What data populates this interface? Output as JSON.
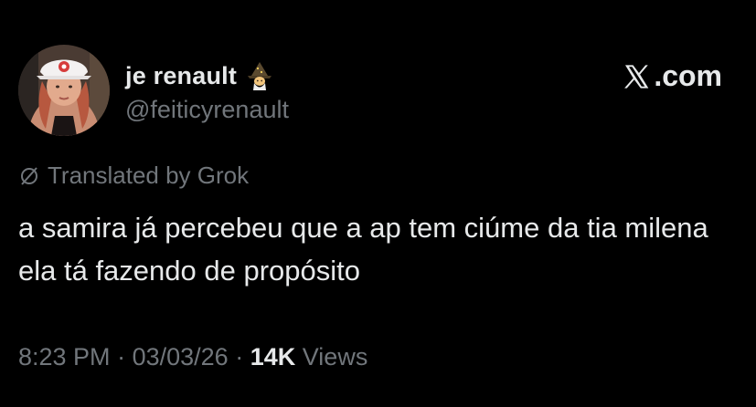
{
  "author": {
    "display_name": "je renault",
    "name_emoji": "mage-emoji",
    "handle": "@feiticyrenault",
    "avatar": "avatar-photo"
  },
  "brand": {
    "logo_icon": "x-logo-icon",
    "label": ".com"
  },
  "translation": {
    "icon": "translate-icon",
    "label": "Translated by Grok"
  },
  "tweet": {
    "text": "a samira já percebeu que a ap tem ciúme da tia milena ela tá fazendo de propósito"
  },
  "meta": {
    "time": "8:23 PM",
    "separator": "·",
    "date": "03/03/26",
    "views_count": "14K",
    "views_label": "Views"
  },
  "colors": {
    "background": "#000000",
    "primary_text": "#e7e9ea",
    "secondary_text": "#71767b"
  }
}
